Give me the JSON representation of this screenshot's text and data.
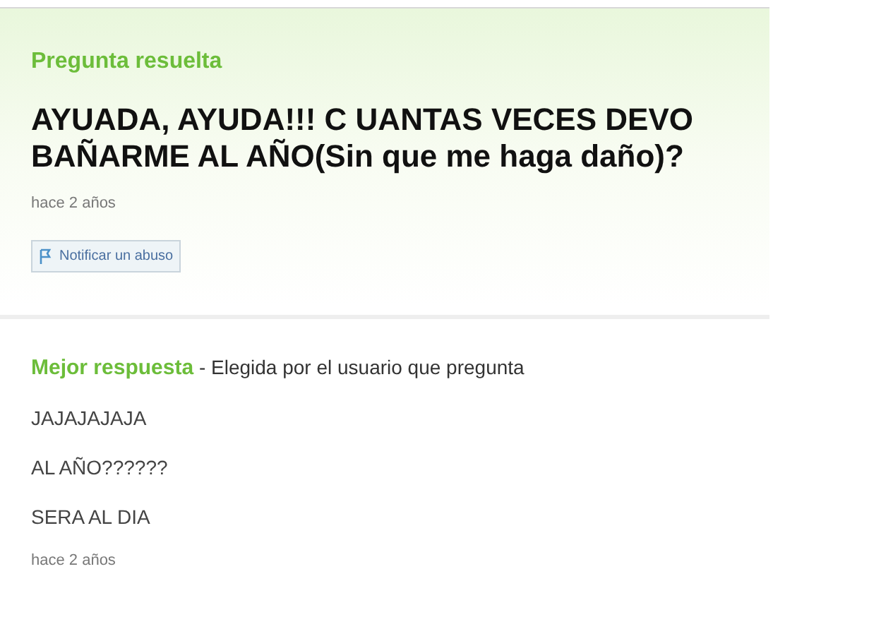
{
  "question": {
    "status": "Pregunta resuelta",
    "title": "AYUADA, AYUDA!!! C UANTAS VECES DEVO BAÑARME AL AÑO(Sin que me haga daño)?",
    "time": "hace 2 años",
    "report_button": "Notificar un abuso"
  },
  "best_answer": {
    "heading": "Mejor respuesta",
    "note": "- Elegida por el usuario que pregunta",
    "lines": [
      "JAJAJAJAJA",
      "AL AÑO??????",
      "SERA AL DIA"
    ],
    "time": "hace 2 años"
  }
}
